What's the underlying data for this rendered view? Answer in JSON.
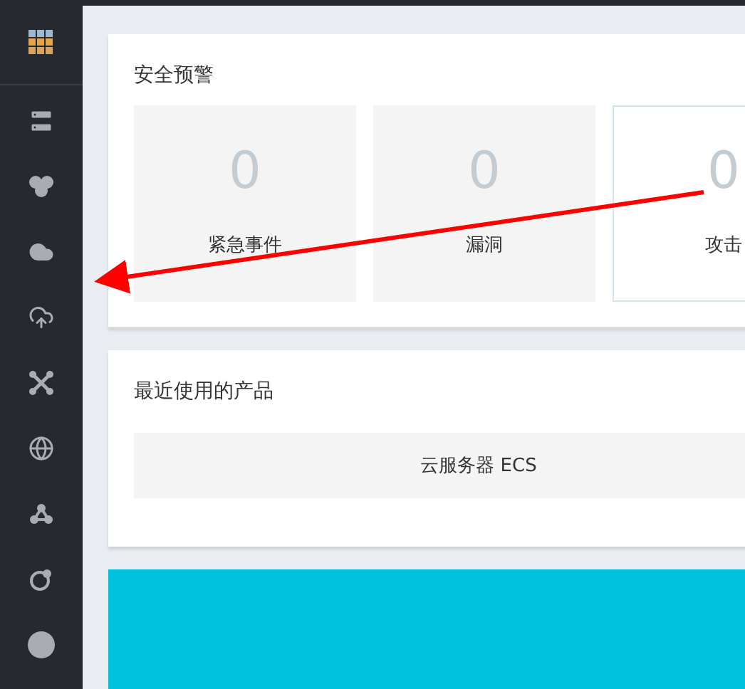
{
  "security_alerts": {
    "title": "安全预警",
    "stats": [
      {
        "value": "0",
        "label": "紧急事件",
        "selected": false
      },
      {
        "value": "0",
        "label": "漏洞",
        "selected": false
      },
      {
        "value": "0",
        "label": "攻击",
        "selected": true
      }
    ]
  },
  "recent_products": {
    "title": "最近使用的产品",
    "products": [
      {
        "name": "云服务器 ECS"
      }
    ]
  }
}
